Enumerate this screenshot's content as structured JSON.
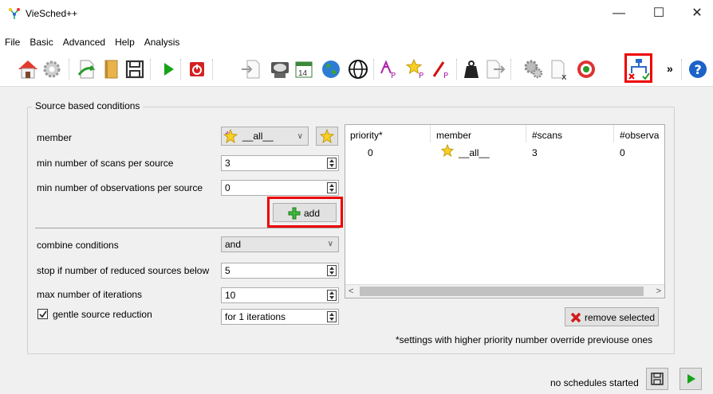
{
  "window": {
    "title": "VieSched++",
    "minimize": "—",
    "maximize": "☐",
    "close": "✕"
  },
  "menu": [
    "File",
    "Basic",
    "Advanced",
    "Help",
    "Analysis"
  ],
  "toolbar": {
    "icons": [
      "home-icon",
      "settings-icon",
      "open-file-icon",
      "book-icon",
      "save-icon",
      "run-icon",
      "power-icon",
      "input-icon",
      "satellite-dish-icon",
      "calendar-icon",
      "globe-icon",
      "network-icon",
      "stations-icon",
      "sources-icon",
      "baseline-icon",
      "weight-icon",
      "output-icon",
      "advanced-settings-icon",
      "simulation-icon",
      "target-icon",
      "conditions-icon",
      "help-icon"
    ],
    "calendar_label": "14",
    "more": "»"
  },
  "group": {
    "title": "Source based conditions",
    "member_label": "member",
    "member_value": "__all__",
    "min_scans_label": "min number of scans per source",
    "min_scans_value": "3",
    "min_obs_label": "min number of observations per source",
    "min_obs_value": "0",
    "add_button": "add",
    "combine_label": "combine conditions",
    "combine_value": "and",
    "stop_label": "stop if number of reduced sources below",
    "stop_value": "5",
    "max_iter_label": "max number of iterations",
    "max_iter_value": "10",
    "gentle_label": "gentle source reduction",
    "gentle_checked": true,
    "gentle_value": "for 1 iterations",
    "remove_button": "remove selected",
    "note": "*settings with higher priority number override previouse ones"
  },
  "table": {
    "headers": [
      "priority*",
      "member",
      "#scans",
      "#observa"
    ],
    "rows": [
      {
        "priority": "0",
        "member": "__all__",
        "scans": "3",
        "observations": "0"
      }
    ]
  },
  "status": {
    "text": "no schedules started"
  },
  "colors": {
    "highlight": "#e00000",
    "panel": "#f0f0f0"
  }
}
